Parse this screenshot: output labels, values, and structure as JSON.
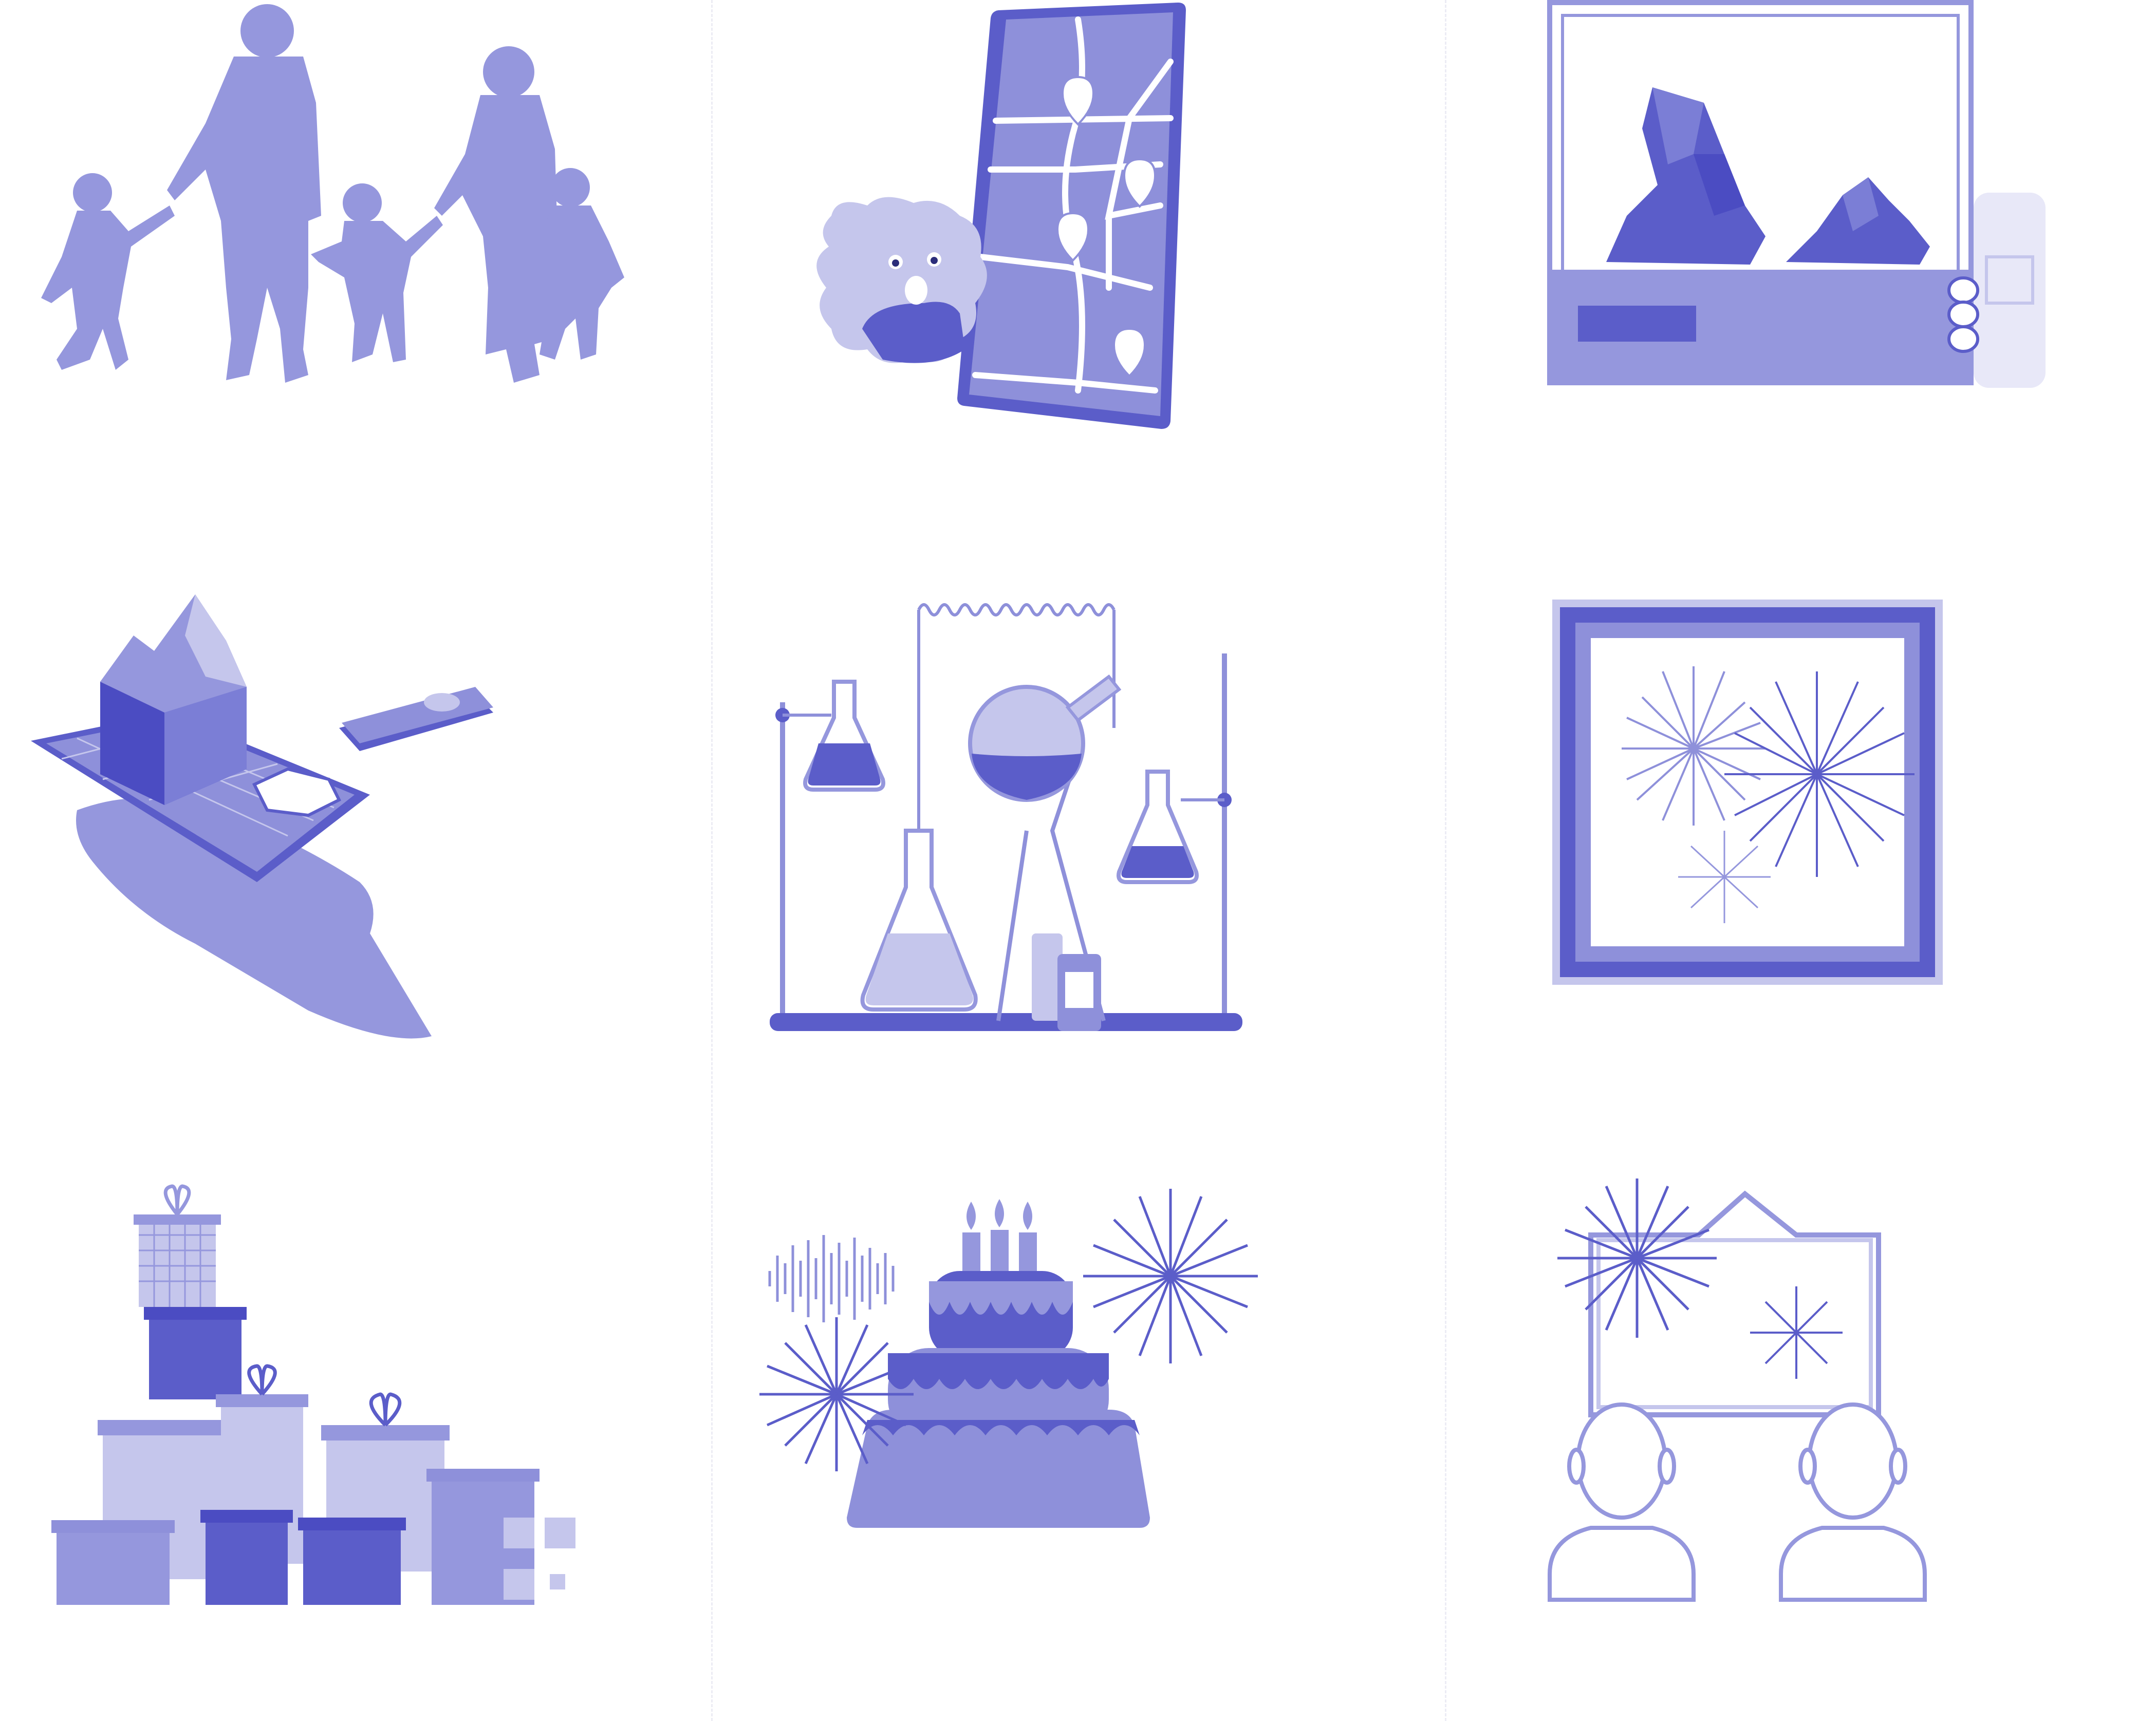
{
  "palette": {
    "light": "#c5c6ec",
    "mid": "#9597dd",
    "main": "#8e90da",
    "dark": "#5b5dc9",
    "deep": "#4b4cc2",
    "white": "#ffffff",
    "divider": "#ececf4"
  },
  "illustrations": [
    {
      "id": "family-walking",
      "icon": "family-silhouette-icon"
    },
    {
      "id": "map-tablet",
      "icon": "tablet-map-monster-icon"
    },
    {
      "id": "rock-display",
      "icon": "framed-rock-exhibit-icon"
    },
    {
      "id": "terrain-phone",
      "icon": "hand-phone-terrain-icon"
    },
    {
      "id": "chemistry-lab",
      "icon": "lab-flasks-icon"
    },
    {
      "id": "framed-fireworks",
      "icon": "framed-fireworks-icon"
    },
    {
      "id": "gift-stack",
      "icon": "gift-boxes-icon"
    },
    {
      "id": "birthday-cake",
      "icon": "cake-fireworks-icon"
    },
    {
      "id": "watching-fireworks",
      "icon": "people-watching-screen-icon"
    }
  ]
}
